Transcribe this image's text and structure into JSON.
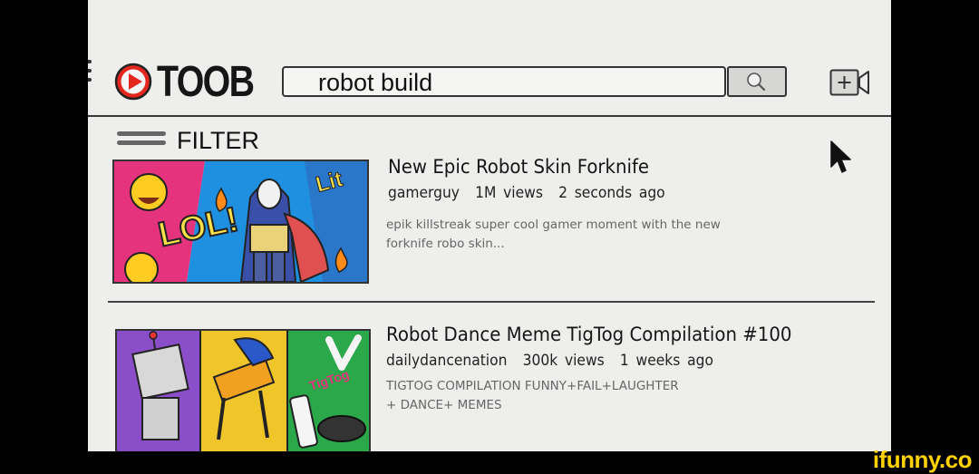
{
  "app": {
    "logo_text": "TOOB"
  },
  "search": {
    "query": "robot build"
  },
  "filter": {
    "label": "FILTER"
  },
  "videos": [
    {
      "title": "New Epic Robot Skin Forknife",
      "channel": "gamerguy",
      "views": "1M views",
      "age": "2 seconds ago",
      "description": "epik killstreak super cool gamer moment with the new forknife robo skin...",
      "thumb_text_1": "LOL!",
      "thumb_text_2": "Lit"
    },
    {
      "title": "Robot Dance Meme TigTog Compilation #100",
      "channel": "dailydancenation",
      "views": "300k  views",
      "age": "1 weeks ago",
      "description_line1": "TIGTOG COMPILATION FUNNY+FAIL+LAUGHTER",
      "description_line2": "+ DANCE+ MEMES",
      "thumb_text_1": "TigTog"
    }
  ],
  "watermark": "ifunny.co",
  "colors": {
    "logo_red": "#e3271f",
    "screen_bg": "#eeefec",
    "watermark_yellow": "#ffd200"
  }
}
